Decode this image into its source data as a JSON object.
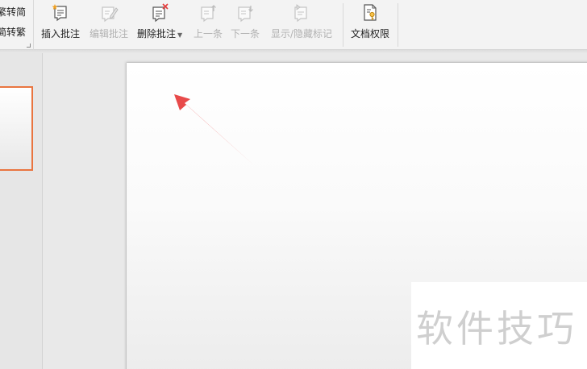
{
  "ribbon": {
    "left_group": {
      "line1": "繁转简",
      "line2": "简转繁"
    },
    "buttons": {
      "insert_comment": "插入批注",
      "edit_comment": "编辑批注",
      "delete_comment": "删除批注",
      "previous": "上一条",
      "next": "下一条",
      "show_hide_markup": "显示/隐藏标记",
      "doc_permissions": "文档权限"
    }
  },
  "watermark": {
    "text": "软件技巧"
  },
  "colors": {
    "accent_orange": "#e9743f",
    "arrow_red": "#e84a4a"
  }
}
